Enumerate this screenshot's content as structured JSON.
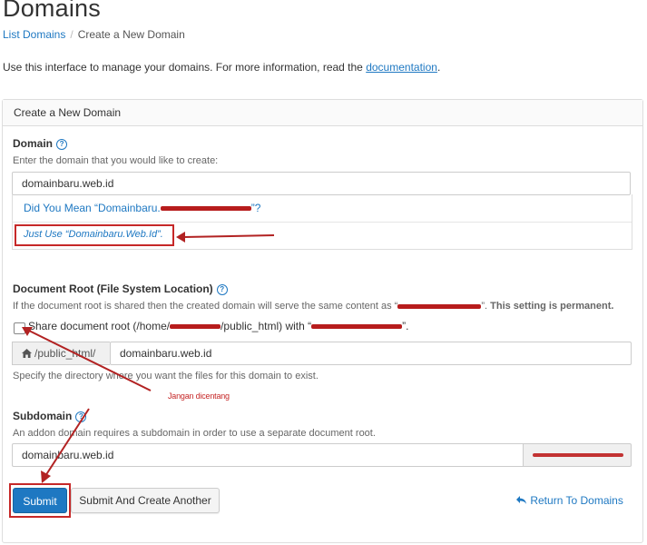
{
  "header": {
    "title": "Domains",
    "breadcrumb": {
      "root": "List Domains",
      "separator": "/",
      "current": "Create a New Domain"
    },
    "intro_text": "Use this interface to manage your domains. For more information, read the ",
    "intro_link": "documentation",
    "intro_end": "."
  },
  "panel": {
    "heading": "Create a New Domain",
    "domain": {
      "label": "Domain",
      "hint": "Enter the domain that you would like to create:",
      "value": "domainbaru.web.id",
      "suggestion_1_prefix": "Did You Mean “Domainbaru.",
      "suggestion_1_suffix": "”?",
      "suggestion_2": "Just Use “Domainbaru.Web.Id”."
    },
    "docroot": {
      "label": "Document Root (File System Location)",
      "hint_prefix": "If the document root is shared then the created domain will serve the same content as “",
      "hint_suffix": "”.",
      "hint_bold": "This setting is permanent.",
      "share_label_a": "Share document root (/home/",
      "share_label_b": "/public_html) with “",
      "share_label_c": "”.",
      "share_checked": false,
      "addon": "/public_html/",
      "value": "domainbaru.web.id",
      "help": "Specify the directory where you want the files for this domain to exist."
    },
    "annotation": "Jangan dicentang",
    "subdomain": {
      "label": "Subdomain",
      "hint": "An addon domain requires a subdomain in order to use a separate document root.",
      "value": "domainbaru.web.id"
    },
    "buttons": {
      "submit": "Submit",
      "submit_another": "Submit And Create Another",
      "return": "Return To Domains"
    }
  },
  "colors": {
    "link": "#1e78c2",
    "primary": "#1e78c2",
    "annotation": "#c62828"
  }
}
